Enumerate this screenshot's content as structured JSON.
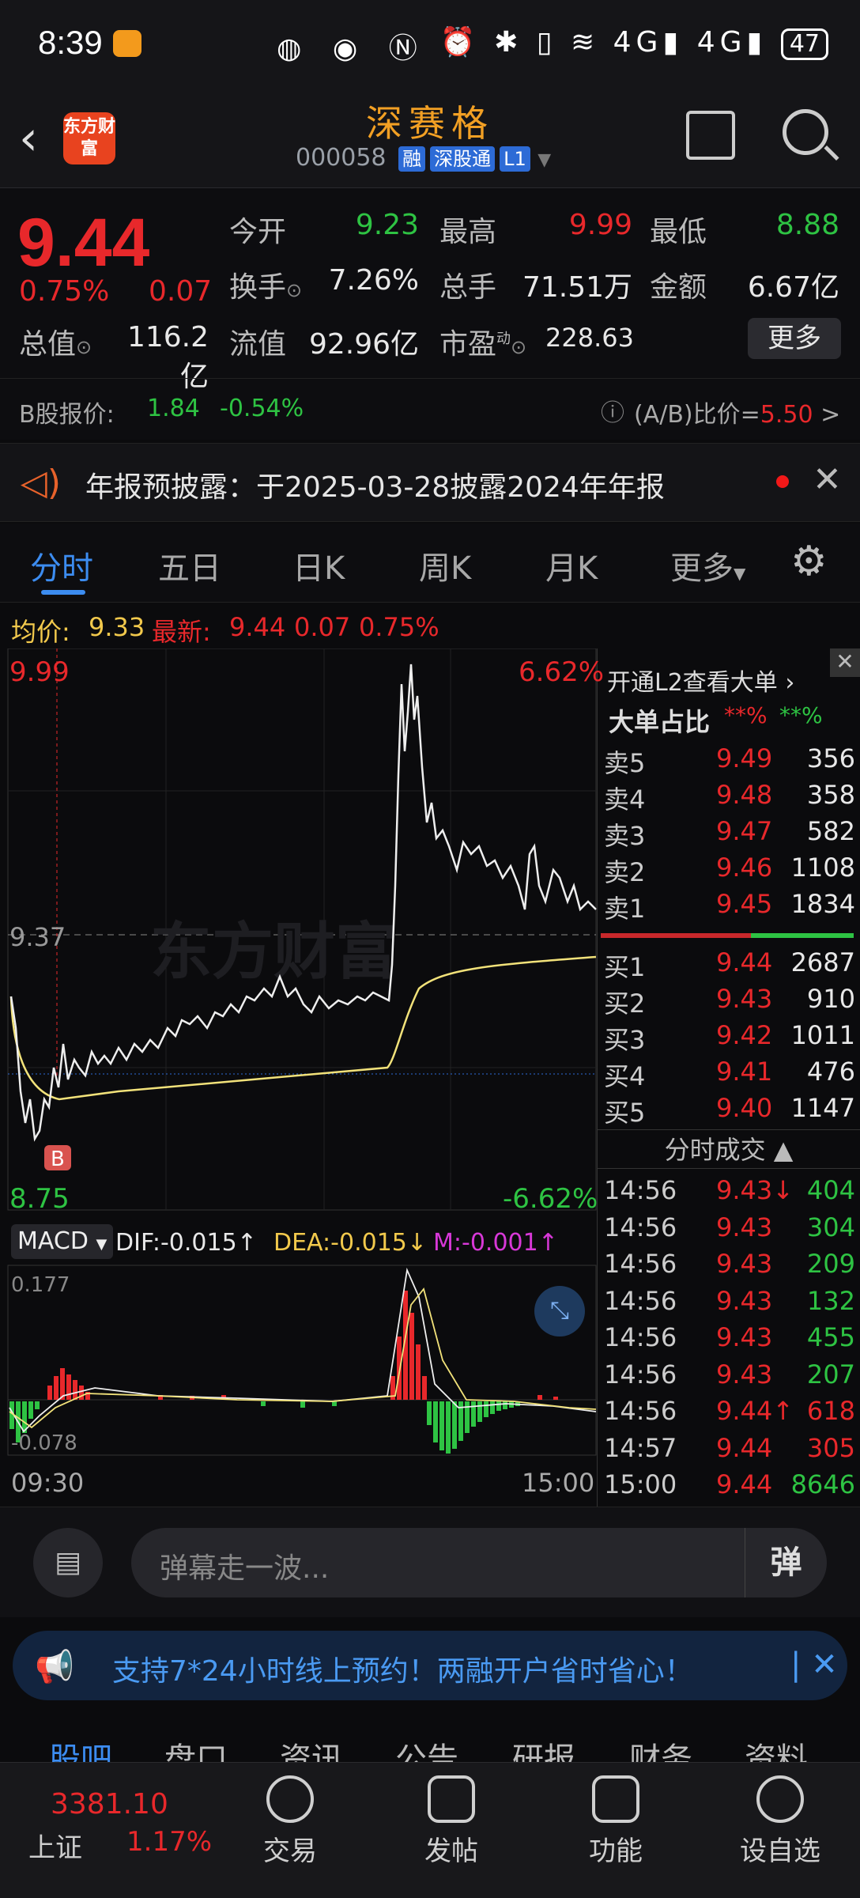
{
  "status_bar": {
    "time": "8:39",
    "battery": "47",
    "net1": "4G",
    "net2": "4G"
  },
  "header": {
    "logo_text": "东方财富",
    "stock_name": "深赛格",
    "stock_code": "000058",
    "tags": [
      "融",
      "深股通",
      "L1"
    ]
  },
  "quote": {
    "price": "9.44",
    "change_pct": "0.75%",
    "change": "0.07",
    "open_label": "今开",
    "open": "9.23",
    "high_label": "最高",
    "high": "9.99",
    "low_label": "最低",
    "low": "8.88",
    "turnover_label": "换手",
    "turnover": "7.26%",
    "volume_label": "总手",
    "volume": "71.51万",
    "amount_label": "金额",
    "amount": "6.67亿",
    "mktcap_label": "总值",
    "mktcap": "116.2亿",
    "float_label": "流值",
    "float": "92.96亿",
    "pe_label": "市盈",
    "pe_sup": "动",
    "pe": "228.63",
    "more": "更多"
  },
  "b_share": {
    "label": "B股报价:",
    "price": "1.84",
    "pct": "-0.54%",
    "ratio_label": "(A/B)比价=",
    "ratio": "5.50",
    "arrow": ">"
  },
  "notice": {
    "text": "年报预披露：于2025-03-28披露2024年年报"
  },
  "tabs": [
    "分时",
    "五日",
    "日K",
    "周K",
    "月K",
    "更多"
  ],
  "info": {
    "avg_label": "均价:",
    "avg": "9.33",
    "latest_label": "最新:",
    "latest": "9.44",
    "chg": "0.07",
    "pct": "0.75%"
  },
  "chart": {
    "top_price": "9.99",
    "top_pct": "6.62%",
    "mid_price": "9.37",
    "bottom_price": "8.75",
    "bottom_pct": "-6.62%",
    "watermark": "东方财富",
    "marker": "B",
    "macd_label": "MACD",
    "dif": "DIF:-0.015",
    "dea": "DEA:-0.015",
    "m": "M:-0.001",
    "macd_top": "0.177",
    "macd_bottom": "-0.078",
    "time_start": "09:30",
    "time_end": "15:00"
  },
  "book": {
    "l2_label": "开通L2查看大单",
    "big_label": "大单占比",
    "big_red": "**%",
    "big_green": "**%",
    "asks": [
      {
        "label": "卖5",
        "price": "9.49",
        "vol": "356"
      },
      {
        "label": "卖4",
        "price": "9.48",
        "vol": "358"
      },
      {
        "label": "卖3",
        "price": "9.47",
        "vol": "582"
      },
      {
        "label": "卖2",
        "price": "9.46",
        "vol": "1108"
      },
      {
        "label": "卖1",
        "price": "9.45",
        "vol": "1834"
      }
    ],
    "bids": [
      {
        "label": "买1",
        "price": "9.44",
        "vol": "2687"
      },
      {
        "label": "买2",
        "price": "9.43",
        "vol": "910"
      },
      {
        "label": "买3",
        "price": "9.42",
        "vol": "1011"
      },
      {
        "label": "买4",
        "price": "9.41",
        "vol": "476"
      },
      {
        "label": "买5",
        "price": "9.40",
        "vol": "1147"
      }
    ],
    "trades_label": "分时成交",
    "trades": [
      {
        "time": "14:56",
        "price": "9.43↓",
        "vol": "404"
      },
      {
        "time": "14:56",
        "price": "9.43",
        "vol": "304"
      },
      {
        "time": "14:56",
        "price": "9.43",
        "vol": "209"
      },
      {
        "time": "14:56",
        "price": "9.43",
        "vol": "132"
      },
      {
        "time": "14:56",
        "price": "9.43",
        "vol": "455"
      },
      {
        "time": "14:56",
        "price": "9.43",
        "vol": "207"
      },
      {
        "time": "14:56",
        "price": "9.44↑",
        "vol": "618"
      },
      {
        "time": "14:57",
        "price": "9.44",
        "vol": "305"
      },
      {
        "time": "15:00",
        "price": "9.44",
        "vol": "8646"
      }
    ]
  },
  "danmu": {
    "placeholder": "弹幕走一波...",
    "btn": "弹"
  },
  "ad": {
    "text": "支持7*24小时线上预约！两融开户省时省心！"
  },
  "subtabs": [
    "股吧",
    "盘口",
    "资讯",
    "公告",
    "研报",
    "财务",
    "资料"
  ],
  "index": {
    "name": "上证",
    "value": "3381.10",
    "pct": "1.17%"
  },
  "nav": [
    "交易",
    "发帖",
    "功能",
    "设自选"
  ]
}
